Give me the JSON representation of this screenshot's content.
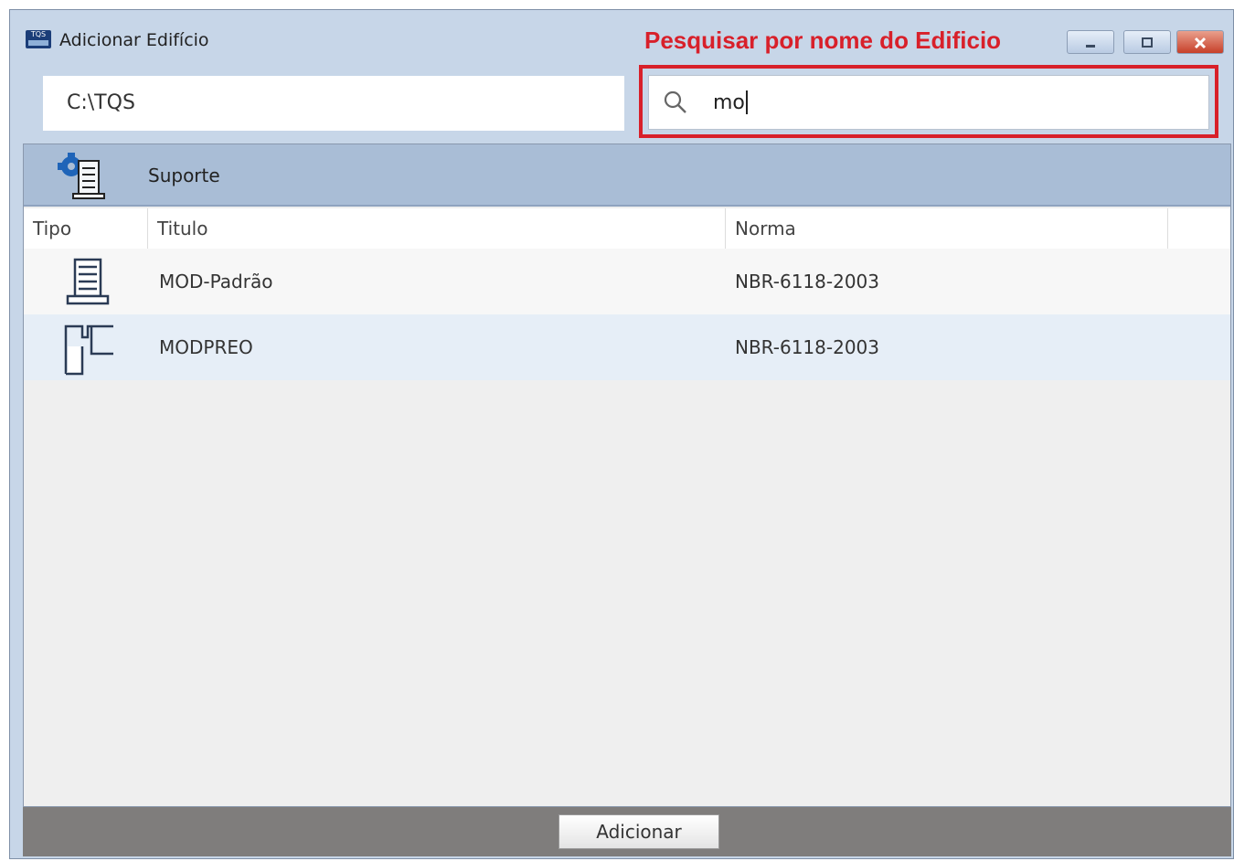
{
  "window": {
    "title": "Adicionar Edifício",
    "app_icon_text": "TQS",
    "annotation": "Pesquisar por nome do Edificio",
    "controls": [
      "minimize-icon",
      "maximize-icon",
      "close-icon"
    ]
  },
  "path": {
    "value": "C:\\TQS"
  },
  "search": {
    "value": "mo",
    "icon": "search-icon"
  },
  "group": {
    "label": "Suporte",
    "icon": "building-gear-icon"
  },
  "table": {
    "columns": [
      "Tipo",
      "Titulo",
      "Norma"
    ],
    "rows": [
      {
        "icon": "building-icon",
        "titulo": "MOD-Padrão",
        "norma": "NBR-6118-2003"
      },
      {
        "icon": "precast-structure-icon",
        "titulo": "MODPREO",
        "norma": "NBR-6118-2003"
      }
    ]
  },
  "footer": {
    "add_label": "Adicionar"
  },
  "colors": {
    "annotation": "#d8202a",
    "header_bar": "#a9bdd6",
    "selected_row": "#e6eef7",
    "footer": "#7f7d7c"
  }
}
